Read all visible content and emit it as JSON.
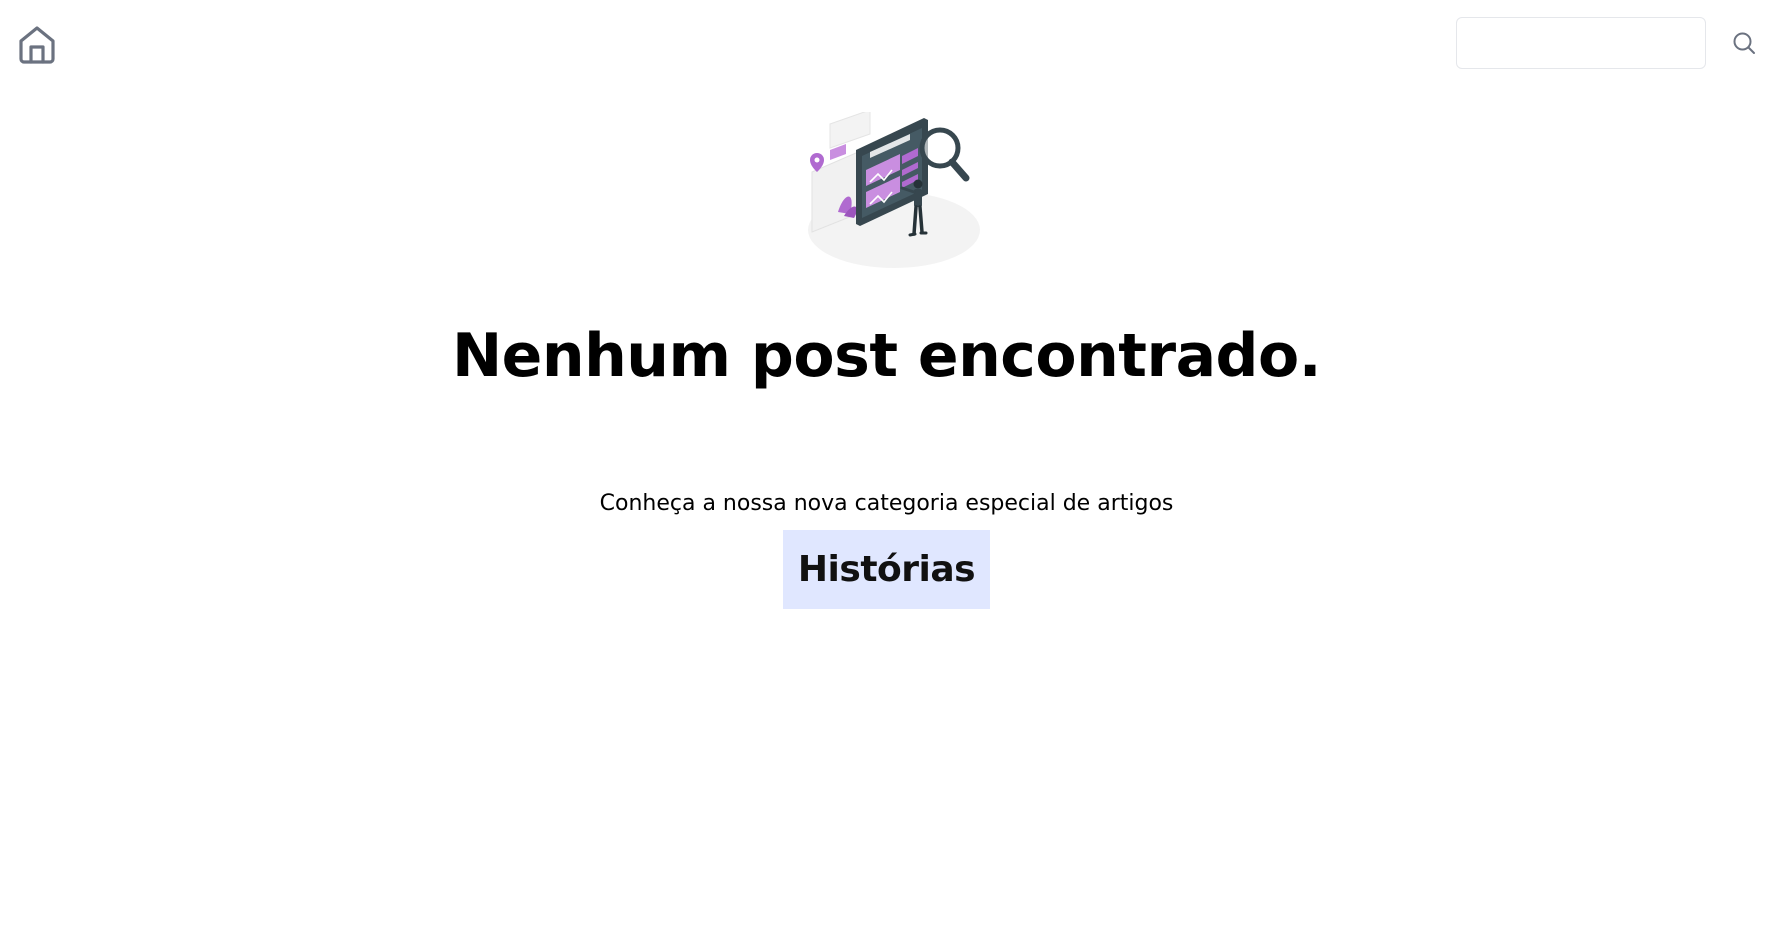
{
  "header": {
    "home_icon": "home-icon",
    "search": {
      "value": "",
      "placeholder": "",
      "icon": "search-icon"
    }
  },
  "main": {
    "illustration": "search-illustration",
    "title": "Nenhum post encontrado.",
    "subtitle": "Conheça a nossa nova categoria especial de artigos",
    "category_label": "Histórias"
  },
  "colors": {
    "accent_bg": "#e0e7ff",
    "illustration_purple": "#b06ad0",
    "illustration_dark": "#37474f",
    "icon_gray": "#6b7280"
  }
}
